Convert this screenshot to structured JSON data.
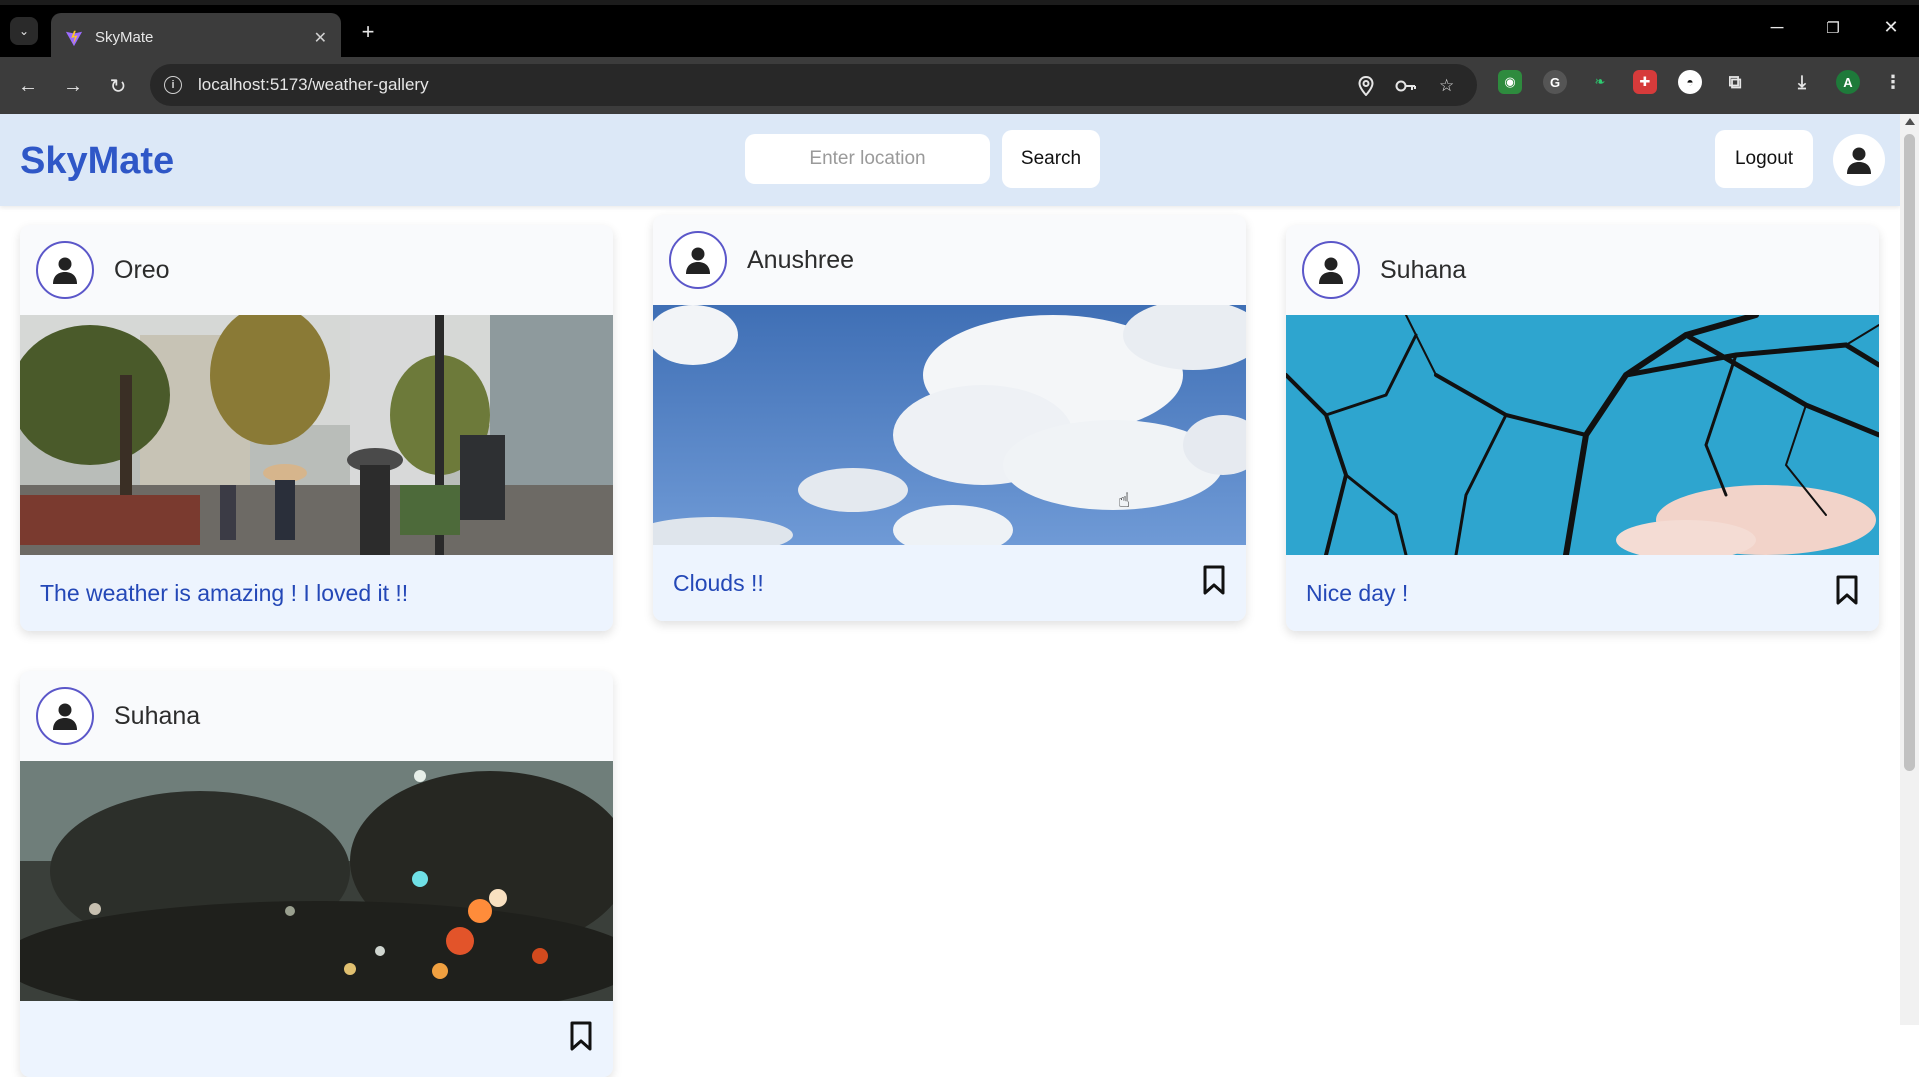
{
  "browser": {
    "tab_title": "SkyMate",
    "url": "localhost:5173/weather-gallery",
    "profile_initial": "A"
  },
  "app": {
    "brand": "SkyMate",
    "search_placeholder": "Enter location",
    "search_label": "Search",
    "logout_label": "Logout",
    "accent_color": "#2f57c7"
  },
  "posts": [
    {
      "user": "Oreo",
      "caption": "The weather is amazing ! I loved it !!",
      "image": "rainy city street with umbrellas",
      "bookmark": false
    },
    {
      "user": "Anushree",
      "caption": "Clouds !!",
      "image": "blue sky with white clouds",
      "bookmark": true
    },
    {
      "user": "Suhana",
      "caption": "Nice day !",
      "image": "bare tree branches against blue sky",
      "bookmark": true
    },
    {
      "user": "Suhana",
      "caption": "",
      "image": "raindrops on window with city lights",
      "bookmark": true
    }
  ]
}
